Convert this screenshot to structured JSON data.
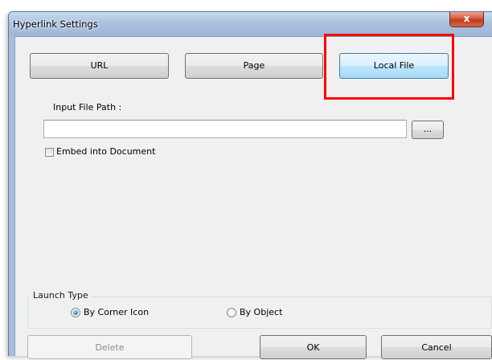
{
  "window": {
    "title": "Hyperlink Settings",
    "close_glyph": "x"
  },
  "tabs": [
    {
      "label": "URL",
      "active": false
    },
    {
      "label": "Page",
      "active": false
    },
    {
      "label": "Local File",
      "active": true
    }
  ],
  "file_section": {
    "path_label": "Input File Path :",
    "path_value": "",
    "browse_label": "...",
    "embed_label": "Embed into Document",
    "embed_checked": false
  },
  "launch_type": {
    "title": "Launch Type",
    "options": [
      {
        "label": "By Corner Icon",
        "checked": true
      },
      {
        "label": "By Object",
        "checked": false
      }
    ]
  },
  "footer": {
    "delete_label": "Delete",
    "ok_label": "OK",
    "cancel_label": "Cancel"
  },
  "colors": {
    "highlight": "#ff0000",
    "active_tab_border": "#3c7fb1"
  }
}
